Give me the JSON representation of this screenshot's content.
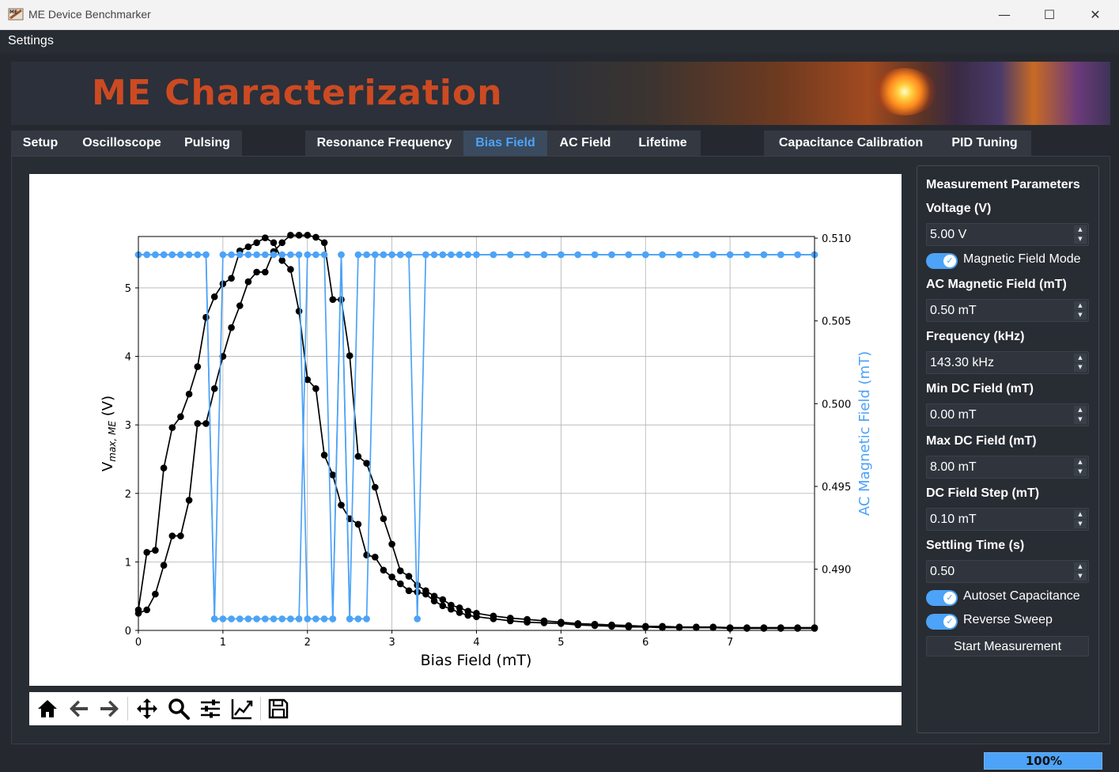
{
  "window": {
    "title": "ME Device Benchmarker",
    "minimize": "—",
    "maximize": "☐",
    "close": "✕"
  },
  "menu": {
    "settings": "Settings"
  },
  "banner": {
    "title": "ME Characterization"
  },
  "tabs": {
    "setup": "Setup",
    "oscilloscope": "Oscilloscope",
    "pulsing": "Pulsing",
    "resonance": "Resonance Frequency",
    "bias_field": "Bias Field",
    "ac_field": "AC Field",
    "lifetime": "Lifetime",
    "capacitance": "Capacitance Calibration",
    "pid": "PID Tuning"
  },
  "params": {
    "header": "Measurement Parameters",
    "voltage_label": "Voltage (V)",
    "voltage_value": "5.00 V",
    "magnetic_mode_label": "Magnetic Field Mode",
    "ac_field_label": "AC Magnetic Field (mT)",
    "ac_field_value": "0.50 mT",
    "frequency_label": "Frequency (kHz)",
    "frequency_value": "143.30 kHz",
    "min_dc_label": "Min DC Field (mT)",
    "min_dc_value": "0.00 mT",
    "max_dc_label": "Max DC Field (mT)",
    "max_dc_value": "8.00 mT",
    "dc_step_label": "DC Field Step (mT)",
    "dc_step_value": "0.10 mT",
    "settling_label": "Settling Time (s)",
    "settling_value": "0.50",
    "autoset_label": "Autoset Capacitance",
    "reverse_label": "Reverse Sweep",
    "start_label": "Start Measurement"
  },
  "status": {
    "progress": "100%",
    "progress_value": 1.0
  },
  "colors": {
    "accent": "#4da3f7",
    "banner_text": "#cc4a22",
    "series_black": "#000000",
    "series_blue": "#4da3f7"
  },
  "toolbar_icons": [
    "home-icon",
    "back-arrow-icon",
    "forward-arrow-icon",
    "pan-icon",
    "zoom-icon",
    "configure-subplots-icon",
    "edit-axes-icon",
    "save-icon"
  ],
  "chart_data": {
    "type": "line",
    "xlabel": "Bias Field (mT)",
    "ylabel": "V_max,ME (V)",
    "y2label": "AC Magnetic Field (mT)",
    "xlim": [
      0,
      8
    ],
    "ylim": [
      0,
      5.75
    ],
    "y2lim": [
      0.4863,
      0.5101
    ],
    "xticks": [
      0,
      1,
      2,
      3,
      4,
      5,
      6,
      7
    ],
    "yticks": [
      0,
      1,
      2,
      3,
      4,
      5
    ],
    "y2ticks": [
      0.49,
      0.495,
      0.5,
      0.505,
      0.51
    ],
    "y2ticklabels": [
      "0.490",
      "0.495",
      "0.500",
      "0.505",
      "0.510"
    ],
    "grid": true,
    "series": [
      {
        "axis": "left",
        "color": "#000000",
        "x": [
          0.0,
          0.1,
          0.2,
          0.3,
          0.4,
          0.5,
          0.6,
          0.7,
          0.8,
          0.9,
          1.0,
          1.1,
          1.2,
          1.3,
          1.4,
          1.5,
          1.6,
          1.7,
          1.8,
          1.9,
          2.0,
          2.1,
          2.2,
          2.3,
          2.4,
          2.5,
          2.6,
          2.7,
          2.8,
          2.9,
          3.0,
          3.1,
          3.2,
          3.3,
          3.4,
          3.5,
          3.6,
          3.7,
          3.8,
          3.9,
          4.0,
          4.2,
          4.4,
          4.6,
          4.8,
          5.0,
          5.2,
          5.4,
          5.6,
          5.8,
          6.0,
          6.2,
          6.4,
          6.6,
          6.8,
          7.0,
          7.2,
          7.4,
          7.6,
          7.8,
          8.0
        ],
        "y": [
          0.3,
          1.14,
          1.17,
          2.37,
          2.96,
          3.12,
          3.45,
          3.85,
          4.57,
          4.87,
          5.06,
          5.14,
          5.54,
          5.6,
          5.66,
          5.73,
          5.66,
          5.4,
          5.27,
          4.66,
          3.66,
          3.53,
          2.56,
          2.27,
          1.83,
          1.63,
          1.55,
          1.1,
          1.07,
          0.88,
          0.78,
          0.68,
          0.58,
          0.56,
          0.53,
          0.43,
          0.36,
          0.31,
          0.26,
          0.22,
          0.2,
          0.17,
          0.14,
          0.12,
          0.11,
          0.1,
          0.08,
          0.07,
          0.06,
          0.05,
          0.05,
          0.04,
          0.04,
          0.04,
          0.04,
          0.03,
          0.03,
          0.03,
          0.03,
          0.03,
          0.03
        ]
      },
      {
        "axis": "left",
        "color": "#000000",
        "x": [
          8.0,
          7.8,
          7.6,
          7.4,
          7.2,
          7.0,
          6.8,
          6.6,
          6.4,
          6.2,
          6.0,
          5.8,
          5.6,
          5.4,
          5.2,
          5.0,
          4.8,
          4.6,
          4.4,
          4.2,
          4.0,
          3.9,
          3.8,
          3.7,
          3.6,
          3.5,
          3.4,
          3.3,
          3.2,
          3.1,
          3.0,
          2.9,
          2.8,
          2.7,
          2.6,
          2.5,
          2.4,
          2.3,
          2.2,
          2.1,
          2.0,
          1.9,
          1.8,
          1.7,
          1.6,
          1.5,
          1.4,
          1.3,
          1.2,
          1.1,
          1.0,
          0.9,
          0.8,
          0.7,
          0.6,
          0.5,
          0.4,
          0.3,
          0.2,
          0.1,
          0.0
        ],
        "y": [
          0.04,
          0.04,
          0.04,
          0.04,
          0.04,
          0.04,
          0.05,
          0.05,
          0.05,
          0.06,
          0.06,
          0.07,
          0.08,
          0.09,
          0.1,
          0.12,
          0.14,
          0.16,
          0.18,
          0.21,
          0.25,
          0.28,
          0.33,
          0.37,
          0.45,
          0.5,
          0.58,
          0.66,
          0.79,
          0.87,
          1.26,
          1.63,
          2.09,
          2.44,
          2.54,
          4.01,
          4.83,
          4.83,
          5.66,
          5.74,
          5.77,
          5.77,
          5.77,
          5.66,
          5.53,
          5.23,
          5.23,
          5.09,
          4.74,
          4.42,
          4.0,
          3.53,
          3.02,
          3.02,
          1.9,
          1.38,
          1.38,
          0.95,
          0.53,
          0.3,
          0.25
        ]
      },
      {
        "axis": "right",
        "color": "#4da3f7",
        "x": [
          0.0,
          0.1,
          0.2,
          0.3,
          0.4,
          0.5,
          0.6,
          0.7,
          0.8,
          0.9,
          1.0,
          1.1,
          1.2,
          1.3,
          1.4,
          1.5,
          1.6,
          1.7,
          1.8,
          1.9,
          2.0,
          2.1,
          2.2,
          2.3,
          2.4,
          2.5,
          2.6,
          2.7,
          2.8,
          2.9,
          3.0,
          3.1,
          3.2,
          3.3,
          3.4,
          3.5,
          3.6,
          3.7,
          3.8,
          3.9,
          4.0,
          4.2,
          4.4,
          4.6,
          4.8,
          5.0,
          5.2,
          5.4,
          5.6,
          5.8,
          6.0,
          6.2,
          6.4,
          6.6,
          6.8,
          7.0,
          7.2,
          7.4,
          7.6,
          7.8,
          8.0
        ],
        "y": [
          0.509,
          0.509,
          0.509,
          0.509,
          0.509,
          0.509,
          0.509,
          0.509,
          0.509,
          0.487,
          0.487,
          0.487,
          0.487,
          0.487,
          0.487,
          0.487,
          0.487,
          0.487,
          0.487,
          0.487,
          0.509,
          0.509,
          0.509,
          0.487,
          0.509,
          0.487,
          0.509,
          0.509,
          0.509,
          0.509,
          0.509,
          0.509,
          0.509,
          0.487,
          0.509,
          0.509,
          0.509,
          0.509,
          0.509,
          0.509,
          0.509,
          0.509,
          0.509,
          0.509,
          0.509,
          0.509,
          0.509,
          0.509,
          0.509,
          0.509,
          0.509,
          0.509,
          0.509,
          0.509,
          0.509,
          0.509,
          0.509,
          0.509,
          0.509,
          0.509,
          0.509
        ]
      },
      {
        "axis": "right",
        "color": "#4da3f7",
        "x": [
          8.0,
          7.8,
          7.6,
          7.4,
          7.2,
          7.0,
          6.8,
          6.6,
          6.4,
          6.2,
          6.0,
          5.8,
          5.6,
          5.4,
          5.2,
          5.0,
          4.8,
          4.6,
          4.4,
          4.2,
          4.0,
          3.8,
          3.6,
          3.4,
          3.2,
          3.1,
          3.0,
          2.9,
          2.8,
          2.7,
          2.6,
          2.5,
          2.4,
          2.3,
          2.2,
          2.1,
          2.0,
          1.9,
          1.8,
          1.7,
          1.6,
          1.5,
          1.4,
          1.3,
          1.2,
          1.1,
          1.0,
          0.9,
          0.8,
          0.7,
          0.6,
          0.5,
          0.4,
          0.3,
          0.2,
          0.1,
          0.0
        ],
        "y": [
          0.509,
          0.509,
          0.509,
          0.509,
          0.509,
          0.509,
          0.509,
          0.509,
          0.509,
          0.509,
          0.509,
          0.509,
          0.509,
          0.509,
          0.509,
          0.509,
          0.509,
          0.509,
          0.509,
          0.509,
          0.509,
          0.509,
          0.509,
          0.509,
          0.509,
          0.509,
          0.509,
          0.509,
          0.509,
          0.487,
          0.487,
          0.487,
          0.509,
          0.487,
          0.487,
          0.487,
          0.487,
          0.509,
          0.509,
          0.509,
          0.509,
          0.509,
          0.509,
          0.509,
          0.509,
          0.509,
          0.509,
          0.487,
          0.509,
          0.509,
          0.509,
          0.509,
          0.509,
          0.509,
          0.509,
          0.509,
          0.509
        ]
      }
    ]
  }
}
